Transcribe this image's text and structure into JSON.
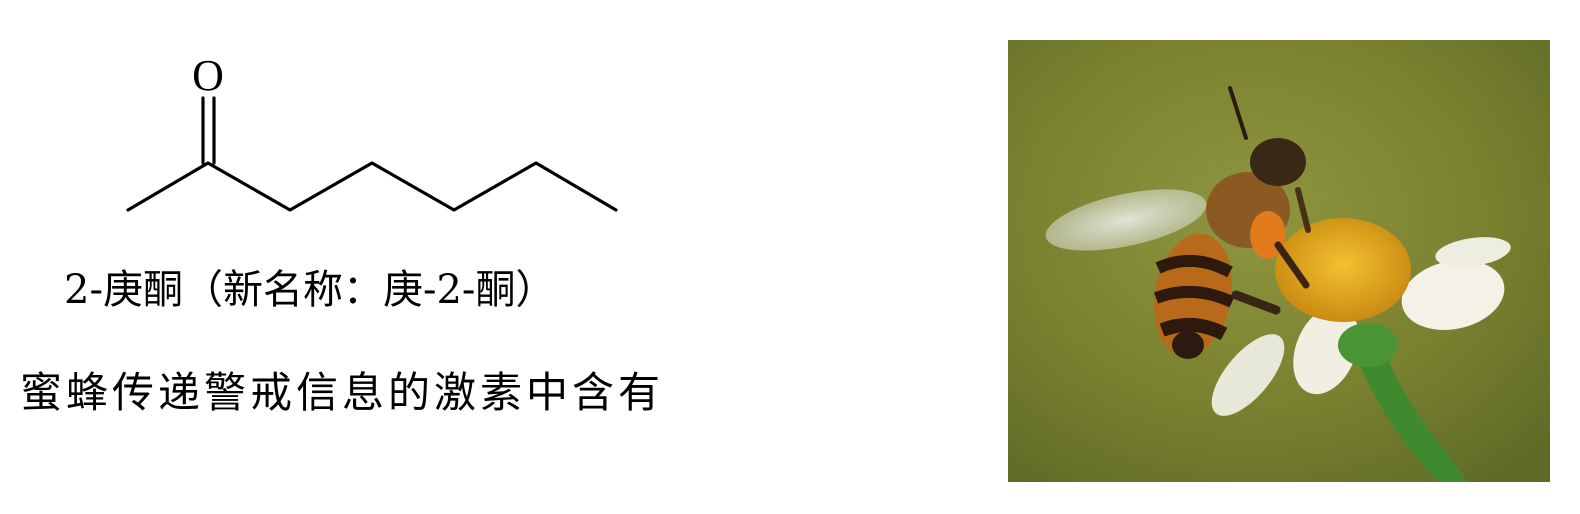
{
  "structure": {
    "oxygen_label": "O"
  },
  "compound_name": "2-庚酮（新名称：庚-2-酮）",
  "description": "蜜蜂传递警戒信息的激素中含有",
  "colors": {
    "line": "#000000",
    "photo_background": "#7c8332",
    "flower_center": "#e0a81c",
    "petal": "#f4f2e6",
    "stem": "#3f8a2e"
  }
}
